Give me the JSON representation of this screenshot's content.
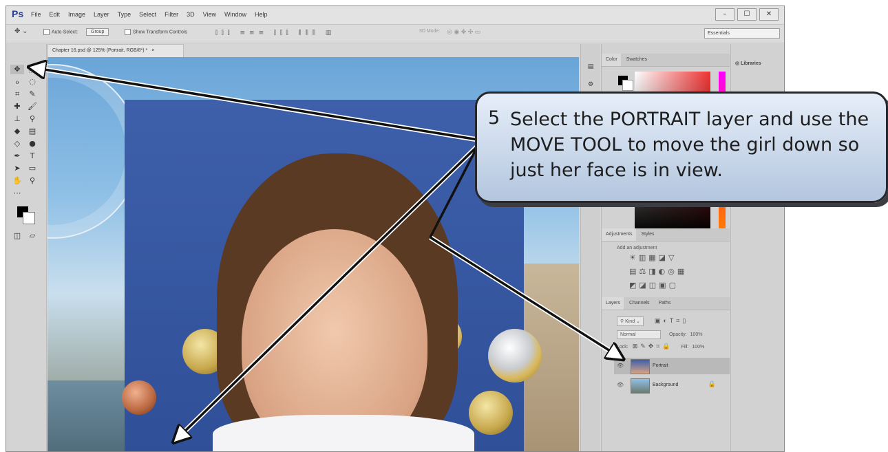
{
  "app": {
    "logo": "Ps",
    "menus": [
      "File",
      "Edit",
      "Image",
      "Layer",
      "Type",
      "Select",
      "Filter",
      "3D",
      "View",
      "Window",
      "Help"
    ],
    "window_controls": [
      "–",
      "☐",
      "✕"
    ]
  },
  "options_bar": {
    "auto_select_label": "Auto-Select:",
    "auto_select_value": "Group",
    "show_transform_label": "Show Transform Controls",
    "mode_3d": "3D Mode:",
    "workspace": "Essentials"
  },
  "document": {
    "tab_title": "Chapter 16.psd @ 125% (Portrait, RGB/8*) *",
    "tab_close": "×"
  },
  "panels": {
    "color": {
      "tabs": [
        "Color",
        "Swatches"
      ]
    },
    "adjustments": {
      "tabs": [
        "Adjustments",
        "Styles"
      ],
      "add_label": "Add an adjustment"
    },
    "layers": {
      "tabs": [
        "Layers",
        "Channels",
        "Paths"
      ],
      "kind": "Kind",
      "blend_mode": "Normal",
      "opacity_label": "Opacity:",
      "opacity_value": "100%",
      "lock_label": "Lock:",
      "fill_label": "Fill:",
      "fill_value": "100%",
      "items": [
        {
          "name": "Portrait",
          "selected": true
        },
        {
          "name": "Background",
          "selected": false,
          "locked": true
        }
      ]
    },
    "libraries": "Libraries"
  },
  "callout": {
    "number": "5",
    "text": "Select the PORTRAIT layer and use the MOVE TOOL to move the girl down so just her face is in view."
  },
  "colors": {
    "callout_top": "#e6eef8",
    "callout_bottom": "#b3c6de",
    "arrow": "#111111"
  }
}
